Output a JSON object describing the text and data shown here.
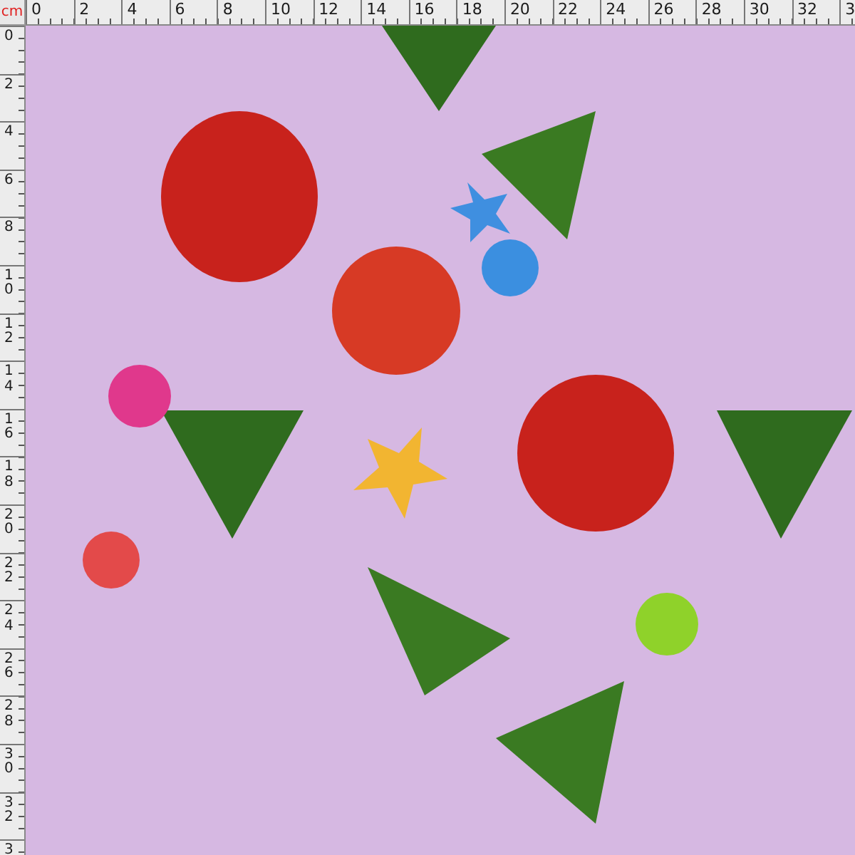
{
  "ruler": {
    "unit": "cm",
    "top_labels": [
      "0",
      "2",
      "4",
      "6",
      "8",
      "10",
      "12",
      "14",
      "16",
      "18",
      "20",
      "22",
      "24",
      "26",
      "28",
      "30",
      "32",
      "3"
    ],
    "left_labels": [
      "0",
      "2",
      "4",
      "6",
      "8",
      "10",
      "12",
      "14",
      "16",
      "18",
      "20",
      "22",
      "24",
      "26",
      "28",
      "30",
      "32",
      "3"
    ]
  }
}
